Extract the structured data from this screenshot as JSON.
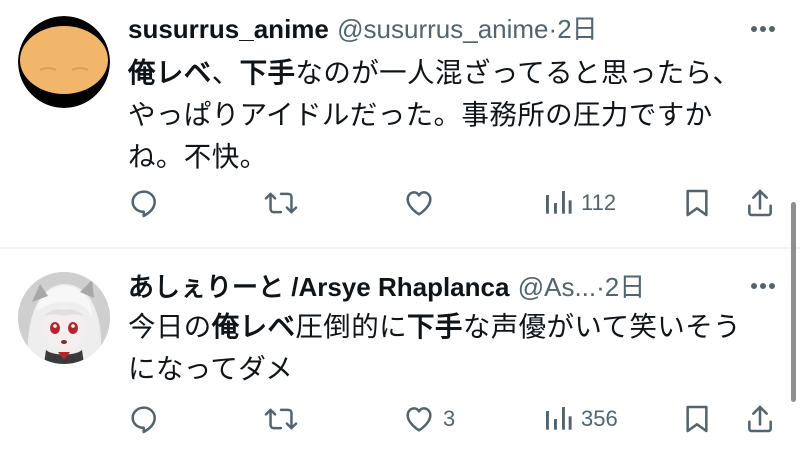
{
  "tweets": [
    {
      "display_name": "susurrus_anime",
      "handle": "@susurrus_anime",
      "separator": "·",
      "time": "2日",
      "body": {
        "line1": [
          {
            "text": "俺レベ",
            "bold": true
          },
          {
            "text": "、",
            "bold": false
          },
          {
            "text": "下手",
            "bold": true
          },
          {
            "text": "なのが一人混ざってると思ったら、",
            "bold": false
          }
        ],
        "line2": "やっぱりアイドルだった。事務所の圧力ですか",
        "line3": "ね。不快。"
      },
      "counts": {
        "reply": "",
        "retweet": "",
        "like": "",
        "views": "112"
      },
      "icons": {
        "avatar": "orange-face-avatar",
        "more": "more-icon",
        "reply": "reply-icon",
        "retweet": "retweet-icon",
        "like": "heart-icon",
        "views": "views-icon",
        "bookmark": "bookmark-icon",
        "share": "share-icon"
      }
    },
    {
      "display_name": "あしぇりーと /Arsye Rhaplanca",
      "handle": "@As...",
      "separator": "·",
      "time": "2日",
      "body": {
        "line1": [
          {
            "text": "今日の",
            "bold": false
          },
          {
            "text": "俺レベ",
            "bold": true
          },
          {
            "text": "圧倒的に",
            "bold": false
          },
          {
            "text": "下手",
            "bold": true
          },
          {
            "text": "な声優がいて笑いそう",
            "bold": false
          }
        ],
        "line2": "になってダメ"
      },
      "counts": {
        "reply": "",
        "retweet": "",
        "like": "3",
        "views": "356"
      },
      "icons": {
        "avatar": "anime-girl-avatar",
        "more": "more-icon",
        "reply": "reply-icon",
        "retweet": "retweet-icon",
        "like": "heart-icon",
        "views": "views-icon",
        "bookmark": "bookmark-icon",
        "share": "share-icon"
      }
    }
  ],
  "colors": {
    "text": "#0f1419",
    "secondary": "#536471",
    "divider": "#eff3f4",
    "avatar1_face": "#f2b66b",
    "avatar1_ring": "#000000"
  }
}
